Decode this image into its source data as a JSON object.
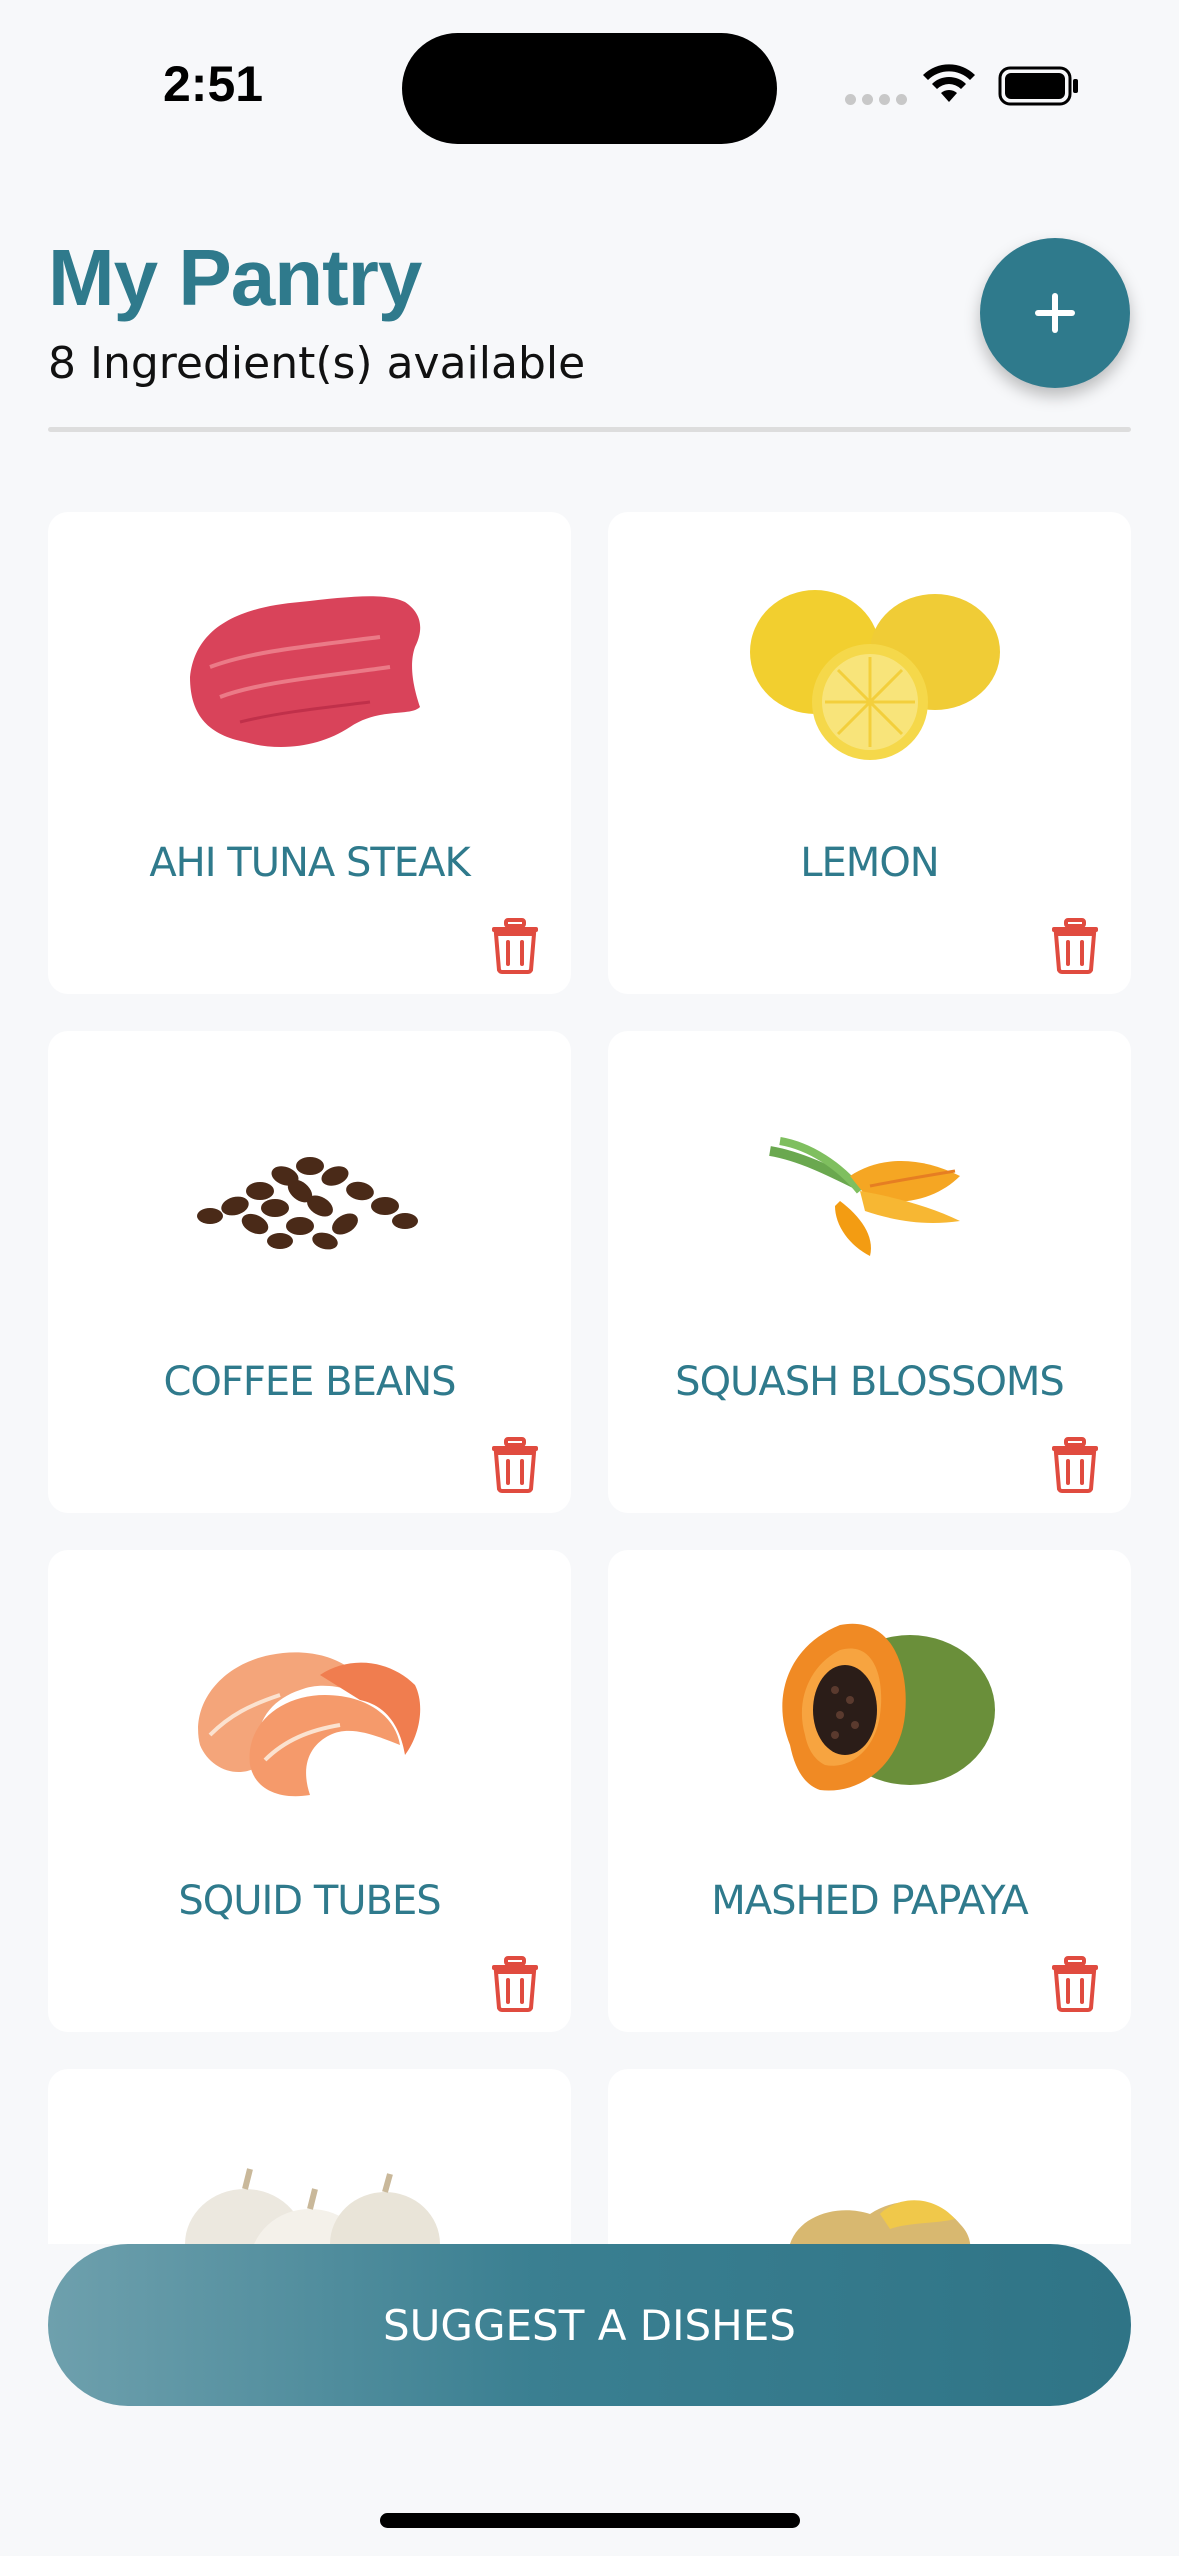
{
  "status_bar": {
    "time": "2:51"
  },
  "header": {
    "title": "My Pantry",
    "subtitle": "8 Ingredient(s) available",
    "add_icon": "plus-icon"
  },
  "ingredients": [
    {
      "name": "AHI TUNA STEAK",
      "image": "tuna-steak-image"
    },
    {
      "name": "LEMON",
      "image": "lemon-image"
    },
    {
      "name": "COFFEE BEANS",
      "image": "coffee-beans-image"
    },
    {
      "name": "SQUASH BLOSSOMS",
      "image": "squash-blossoms-image"
    },
    {
      "name": "SQUID TUBES",
      "image": "shrimp-image"
    },
    {
      "name": "MASHED PAPAYA",
      "image": "papaya-image"
    },
    {
      "name": "",
      "image": "garlic-image"
    },
    {
      "name": "",
      "image": "ginger-image"
    }
  ],
  "actions": {
    "suggest_label": "SUGGEST A DISHES"
  },
  "colors": {
    "accent": "#2f7a8c",
    "delete": "#e04b3f",
    "background": "#f7f8fa"
  }
}
